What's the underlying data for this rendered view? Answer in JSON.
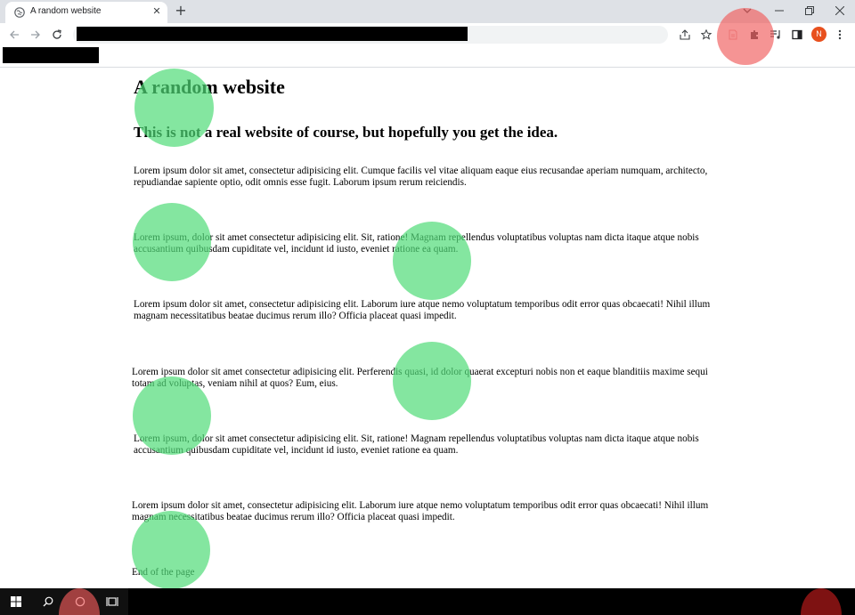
{
  "browser": {
    "tab": {
      "title": "A random website",
      "favicon": "globe-icon",
      "close_icon": "close-icon"
    },
    "new_tab_icon": "plus-icon",
    "tab_search_icon": "chevron-down-icon",
    "window_controls": [
      "minimize-icon",
      "restore-icon",
      "close-icon"
    ],
    "toolbar": {
      "back_icon": "arrow-left-icon",
      "forward_icon": "arrow-right-icon",
      "reload_icon": "reload-icon",
      "url": "[redacted]",
      "right_icons": [
        "share-icon",
        "star-icon",
        "document-extension-icon",
        "puzzle-icon",
        "media-control-icon",
        "side-panel-icon"
      ],
      "profile_initial": "N",
      "menu_icon": "kebab-menu-icon"
    },
    "bookmarks_bar": {
      "item": "[redacted]"
    }
  },
  "page": {
    "title": "A random website",
    "subtitle": "This is not a real website of course, but hopefully you get the idea.",
    "paragraphs": [
      "Lorem ipsum dolor sit amet, consectetur adipisicing elit. Cumque facilis vel vitae aliquam eaque eius recusandae aperiam numquam, architecto, repudiandae sapiente optio, odit omnis esse fugit. Laborum ipsum rerum reiciendis.",
      "Lorem ipsum, dolor sit amet consectetur adipisicing elit. Sit, ratione! Magnam repellendus voluptatibus voluptas nam dicta itaque atque nobis accusantium quibusdam cupiditate vel, incidunt id iusto, eveniet ratione ea quam.",
      "Lorem ipsum dolor sit amet, consectetur adipisicing elit. Laborum iure atque nemo voluptatum temporibus odit error quas obcaecati! Nihil illum magnam necessitatibus beatae ducimus rerum illo? Officia placeat quasi impedit.",
      "Lorem ipsum dolor sit amet consectetur adipisicing elit. Perferendis quasi, id dolor quaerat excepturi nobis non et eaque blanditiis maxime sequi totam ad voluptas, veniam nihil at quos? Eum, eius.",
      "Lorem ipsum, dolor sit amet consectetur adipisicing elit. Sit, ratione! Magnam repellendus voluptatibus voluptas nam dicta itaque atque nobis accusantium quibusdam cupiditate vel, incidunt id iusto, eveniet ratione ea quam.",
      "Lorem ipsum dolor sit amet, consectetur adipisicing elit. Laborum iure atque nemo voluptatum temporibus odit error quas obcaecati! Nihil illum magnam necessitatibus beatae ducimus rerum illo? Officia placeat quasi impedit."
    ],
    "footer_text": "End of the page"
  },
  "taskbar": {
    "icons": [
      "windows-start-icon",
      "search-icon",
      "cortana-icon",
      "task-view-icon"
    ]
  },
  "colors": {
    "highlight_green": "#50dc78",
    "highlight_red": "#f05a5a",
    "highlight_dark_red": "#8c1414",
    "profile_avatar": "#e8501e"
  }
}
